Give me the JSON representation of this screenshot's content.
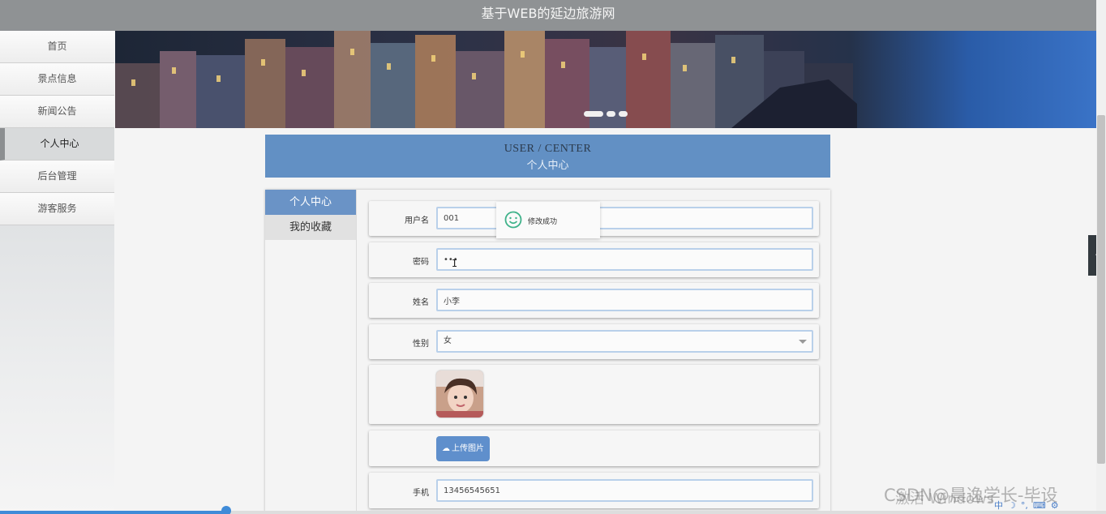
{
  "site": {
    "title": "基于WEB的延边旅游网"
  },
  "nav": {
    "items": [
      {
        "label": "首页"
      },
      {
        "label": "景点信息"
      },
      {
        "label": "新闻公告"
      },
      {
        "label": "个人中心",
        "active": true
      },
      {
        "label": "后台管理"
      },
      {
        "label": "游客服务"
      }
    ]
  },
  "banner": {
    "active_slide": 1,
    "slide_count": 3
  },
  "center": {
    "title_en": "USER / CENTER",
    "title_cn": "个人中心"
  },
  "tabs": [
    {
      "label": "个人中心",
      "active": true
    },
    {
      "label": "我的收藏"
    }
  ],
  "form": {
    "username": {
      "label": "用户名",
      "value": "001"
    },
    "password": {
      "label": "密码",
      "value": "•••"
    },
    "name": {
      "label": "姓名",
      "value": "小李"
    },
    "gender": {
      "label": "性别",
      "value": "女"
    },
    "upload_label": "上传图片",
    "phone": {
      "label": "手机",
      "value": "13456545651"
    }
  },
  "toast": {
    "message": "修改成功"
  },
  "video": {
    "progress": 0.205
  },
  "overlay": {
    "watermark": "CSDN@晨逸学长-毕设",
    "activation": "激活 Windows"
  },
  "colors": {
    "accent": "#6290c4",
    "topbar": "#8f9294",
    "tab_active": "#6a93c6",
    "button": "#5f8fcc"
  }
}
